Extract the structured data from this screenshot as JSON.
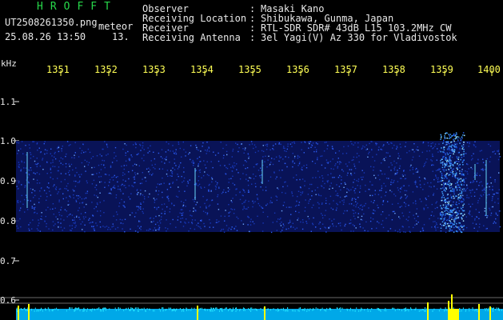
{
  "header": {
    "logo": "HROFFT",
    "filename": "UT2508261350.png",
    "subtitle": "meteor",
    "datetime": "25.08.26 13:50",
    "counter": "13."
  },
  "info": [
    {
      "label": "Observer",
      "value": "Masaki Kano"
    },
    {
      "label": "Receiving Location",
      "value": "Shibukawa, Gunma, Japan"
    },
    {
      "label": "Receiver",
      "value": "RTL-SDR SDR# 43dB L15 103.2MHz CW"
    },
    {
      "label": "Receiving Antenna",
      "value": "3el Yagi(V) Az 330 for Vladivostok"
    }
  ],
  "axis": {
    "unit": "kHz",
    "y_ticks": [
      "1.1",
      "1.0",
      "0.9",
      "0.8",
      "0.7",
      "0.6"
    ],
    "x_ticks": [
      "1351",
      "1352",
      "1353",
      "1354",
      "1355",
      "1356",
      "1357",
      "1358",
      "1359",
      "1400"
    ]
  },
  "colors": {
    "logo": "#27d84a",
    "text": "#e8e8e8",
    "tick_label": "#ffff55",
    "background": "#000000",
    "noise_band": "#1030c0",
    "echo": "#88ffff",
    "bottom_band": "#00c8ff"
  }
}
